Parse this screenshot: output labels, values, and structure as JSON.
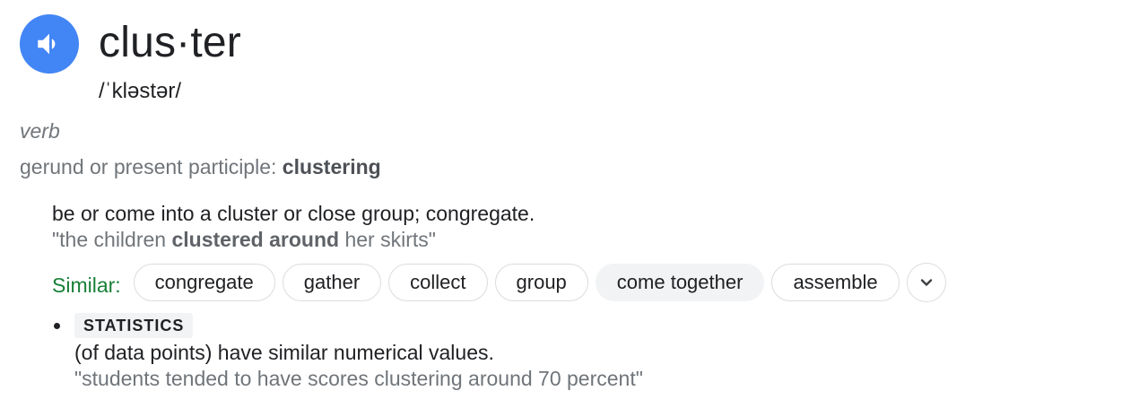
{
  "entry": {
    "headword": "clus·ter",
    "phonetic": "/ˈkləstər/",
    "part_of_speech": "verb",
    "forms_label": "gerund or present participle",
    "forms_sep": ": ",
    "forms_word": "clustering"
  },
  "sense1": {
    "definition": "be or come into a cluster or close group; congregate.",
    "example_pre": "\"the children ",
    "example_bold": "clustered around",
    "example_post": " her skirts\"",
    "similar_label": "Similar:",
    "similar": [
      "congregate",
      "gather",
      "collect",
      "group",
      "come together",
      "assemble"
    ]
  },
  "sense2": {
    "label": "STATISTICS",
    "definition": "(of data points) have similar numerical values.",
    "example": "\"students tended to have scores clustering around 70 percent\""
  },
  "icons": {
    "audio": "speaker-icon",
    "expand": "chevron-down-icon"
  },
  "colors": {
    "audio_button": "#4285f4",
    "similar_label": "#188038",
    "muted_text": "#70757a",
    "chip_border": "#dadce0",
    "chip_filled": "#f1f3f4"
  }
}
